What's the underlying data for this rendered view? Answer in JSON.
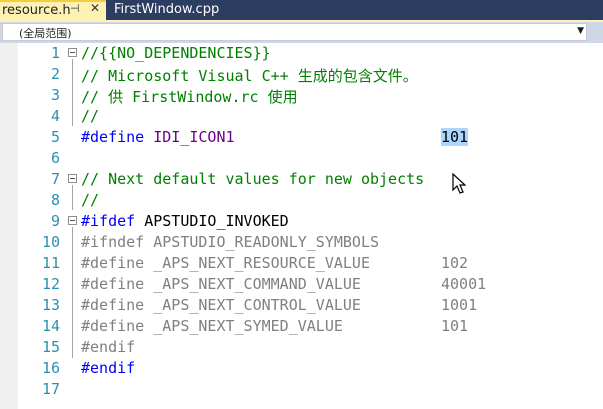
{
  "tabs": [
    {
      "label": "resource.h",
      "pin": "⊣",
      "close": "✕",
      "active": true
    },
    {
      "label": "FirstWindow.cpp",
      "active": false
    }
  ],
  "scope": {
    "value": "(全局范围)"
  },
  "lines": [
    {
      "no": "1",
      "fold": "open",
      "segs": [
        {
          "t": "//{{NO_DEPENDENCIES}}",
          "c": "green"
        }
      ]
    },
    {
      "no": "2",
      "segs": [
        {
          "t": "// Microsoft Visual C++ 生成的包含文件。",
          "c": "green"
        }
      ]
    },
    {
      "no": "3",
      "segs": [
        {
          "t": "// 供 FirstWindow.rc 使用",
          "c": "green"
        }
      ]
    },
    {
      "no": "4",
      "segs": [
        {
          "t": "//",
          "c": "green"
        }
      ]
    },
    {
      "no": "5",
      "segs": [
        {
          "t": "#define",
          "c": "blue"
        },
        {
          "t": " ",
          "c": "black"
        },
        {
          "t": "IDI_ICON1",
          "c": "purple"
        }
      ],
      "value": "101",
      "selected": true
    },
    {
      "no": "6",
      "segs": []
    },
    {
      "no": "7",
      "fold": "open",
      "segs": [
        {
          "t": "// Next default values for new objects",
          "c": "green"
        }
      ]
    },
    {
      "no": "8",
      "segs": [
        {
          "t": "//",
          "c": "green"
        }
      ]
    },
    {
      "no": "9",
      "fold": "open",
      "segs": [
        {
          "t": "#ifdef",
          "c": "blue"
        },
        {
          "t": " APSTUDIO_INVOKED",
          "c": "black"
        }
      ]
    },
    {
      "no": "10",
      "segs": [
        {
          "t": "#ifndef APSTUDIO_READONLY_SYMBOLS",
          "c": "gray"
        }
      ]
    },
    {
      "no": "11",
      "segs": [
        {
          "t": "#define _APS_NEXT_RESOURCE_VALUE",
          "c": "gray"
        }
      ],
      "value": "102",
      "valueColor": "gray"
    },
    {
      "no": "12",
      "segs": [
        {
          "t": "#define _APS_NEXT_COMMAND_VALUE",
          "c": "gray"
        }
      ],
      "value": "40001",
      "valueColor": "gray"
    },
    {
      "no": "13",
      "segs": [
        {
          "t": "#define _APS_NEXT_CONTROL_VALUE",
          "c": "gray"
        }
      ],
      "value": "1001",
      "valueColor": "gray"
    },
    {
      "no": "14",
      "segs": [
        {
          "t": "#define _APS_NEXT_SYMED_VALUE",
          "c": "gray"
        }
      ],
      "value": "101",
      "valueColor": "gray"
    },
    {
      "no": "15",
      "segs": [
        {
          "t": "#endif",
          "c": "gray"
        }
      ]
    },
    {
      "no": "16",
      "segs": [
        {
          "t": "#endif",
          "c": "blue"
        }
      ]
    },
    {
      "no": "17",
      "segs": []
    }
  ]
}
